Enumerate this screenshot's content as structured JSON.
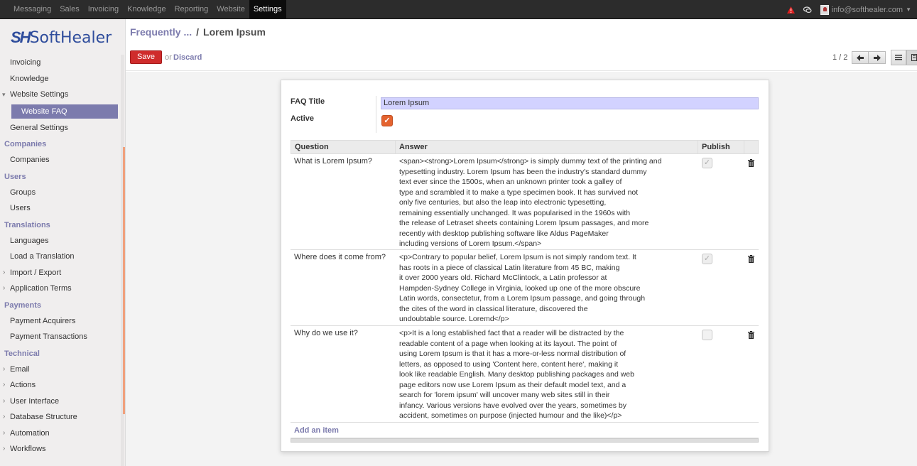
{
  "topbar": {
    "menu": [
      "Messaging",
      "Sales",
      "Invoicing",
      "Knowledge",
      "Reporting",
      "Website",
      "Settings"
    ],
    "active_menu": "Settings",
    "user_email": "info@softhealer.com"
  },
  "logo": {
    "mark": "SH",
    "text": "SoftHealer"
  },
  "sidebar": {
    "items": [
      {
        "type": "row",
        "label": "Invoicing"
      },
      {
        "type": "row",
        "label": "Knowledge"
      },
      {
        "type": "row-open",
        "label": "Website Settings"
      },
      {
        "type": "selected",
        "label": "Website FAQ"
      },
      {
        "type": "row",
        "label": "General Settings"
      },
      {
        "type": "section",
        "label": "Companies"
      },
      {
        "type": "row",
        "label": "Companies"
      },
      {
        "type": "section",
        "label": "Users"
      },
      {
        "type": "row",
        "label": "Groups"
      },
      {
        "type": "row",
        "label": "Users"
      },
      {
        "type": "section",
        "label": "Translations"
      },
      {
        "type": "row",
        "label": "Languages"
      },
      {
        "type": "row",
        "label": "Load a Translation"
      },
      {
        "type": "row-arrow",
        "label": "Import / Export"
      },
      {
        "type": "row-arrow",
        "label": "Application Terms"
      },
      {
        "type": "section",
        "label": "Payments"
      },
      {
        "type": "row",
        "label": "Payment Acquirers"
      },
      {
        "type": "row",
        "label": "Payment Transactions"
      },
      {
        "type": "section",
        "label": "Technical"
      },
      {
        "type": "row-arrow",
        "label": "Email"
      },
      {
        "type": "row-arrow",
        "label": "Actions"
      },
      {
        "type": "row-arrow",
        "label": "User Interface"
      },
      {
        "type": "row-arrow",
        "label": "Database Structure"
      },
      {
        "type": "row-arrow",
        "label": "Automation"
      },
      {
        "type": "row-arrow",
        "label": "Workflows"
      }
    ]
  },
  "breadcrumb": {
    "parent": "Frequently ...",
    "separator": "/",
    "current": "Lorem Ipsum"
  },
  "actions": {
    "save": "Save",
    "or": "or",
    "discard": "Discard"
  },
  "pager": {
    "text": "1 / 2"
  },
  "form": {
    "faq_title_label": "FAQ Title",
    "faq_title_value": "Lorem Ipsum",
    "active_label": "Active",
    "active_checked": true,
    "columns": {
      "question": "Question",
      "answer": "Answer",
      "publish": "Publish"
    },
    "rows": [
      {
        "question": "What is Lorem Ipsum?",
        "answer": "<span><strong>Lorem Ipsum</strong> is simply dummy text of the printing and\ntypesetting industry. Lorem Ipsum has been the industry's standard dummy\ntext ever since the 1500s, when an unknown printer took a galley of\ntype and scrambled it to make a type specimen book. It has survived not\nonly five centuries, but also the leap into electronic typesetting,\nremaining essentially unchanged. It was popularised in the 1960s with\nthe release of Letraset sheets containing Lorem Ipsum passages, and more\nrecently with desktop publishing software like Aldus PageMaker\nincluding versions of Lorem Ipsum.</span>",
        "published": true
      },
      {
        "question": "Where does it come from?",
        "answer": "<p>Contrary to popular belief, Lorem Ipsum is not simply random text. It\nhas roots in a piece of classical Latin literature from 45 BC, making\nit over 2000 years old. Richard McClintock, a Latin professor at\nHampden-Sydney College in Virginia, looked up one of the more obscure\nLatin words, consectetur, from a Lorem Ipsum passage, and going through\nthe cites of the word in classical literature, discovered the\nundoubtable source. Loremd</p>",
        "published": true
      },
      {
        "question": "Why do we use it?",
        "answer": "<p>It is a long established fact that a reader will be distracted by the\nreadable content of a page when looking at its layout. The point of\nusing Lorem Ipsum is that it has a more-or-less normal distribution of\nletters, as opposed to using 'Content here, content here', making it\nlook like readable English. Many desktop publishing packages and web\npage editors now use Lorem Ipsum as their default model text, and a\nsearch for 'lorem ipsum' will uncover many web sites still in their\ninfancy. Various versions have evolved over the years, sometimes by\naccident, sometimes on purpose (injected humour and the like)</p>",
        "published": false
      }
    ],
    "add_item": "Add an item"
  },
  "colors": {
    "accent": "#7c7bad",
    "save": "#cf2c2c",
    "checkbox": "#e4632f",
    "topbar": "#2c2c2c"
  }
}
